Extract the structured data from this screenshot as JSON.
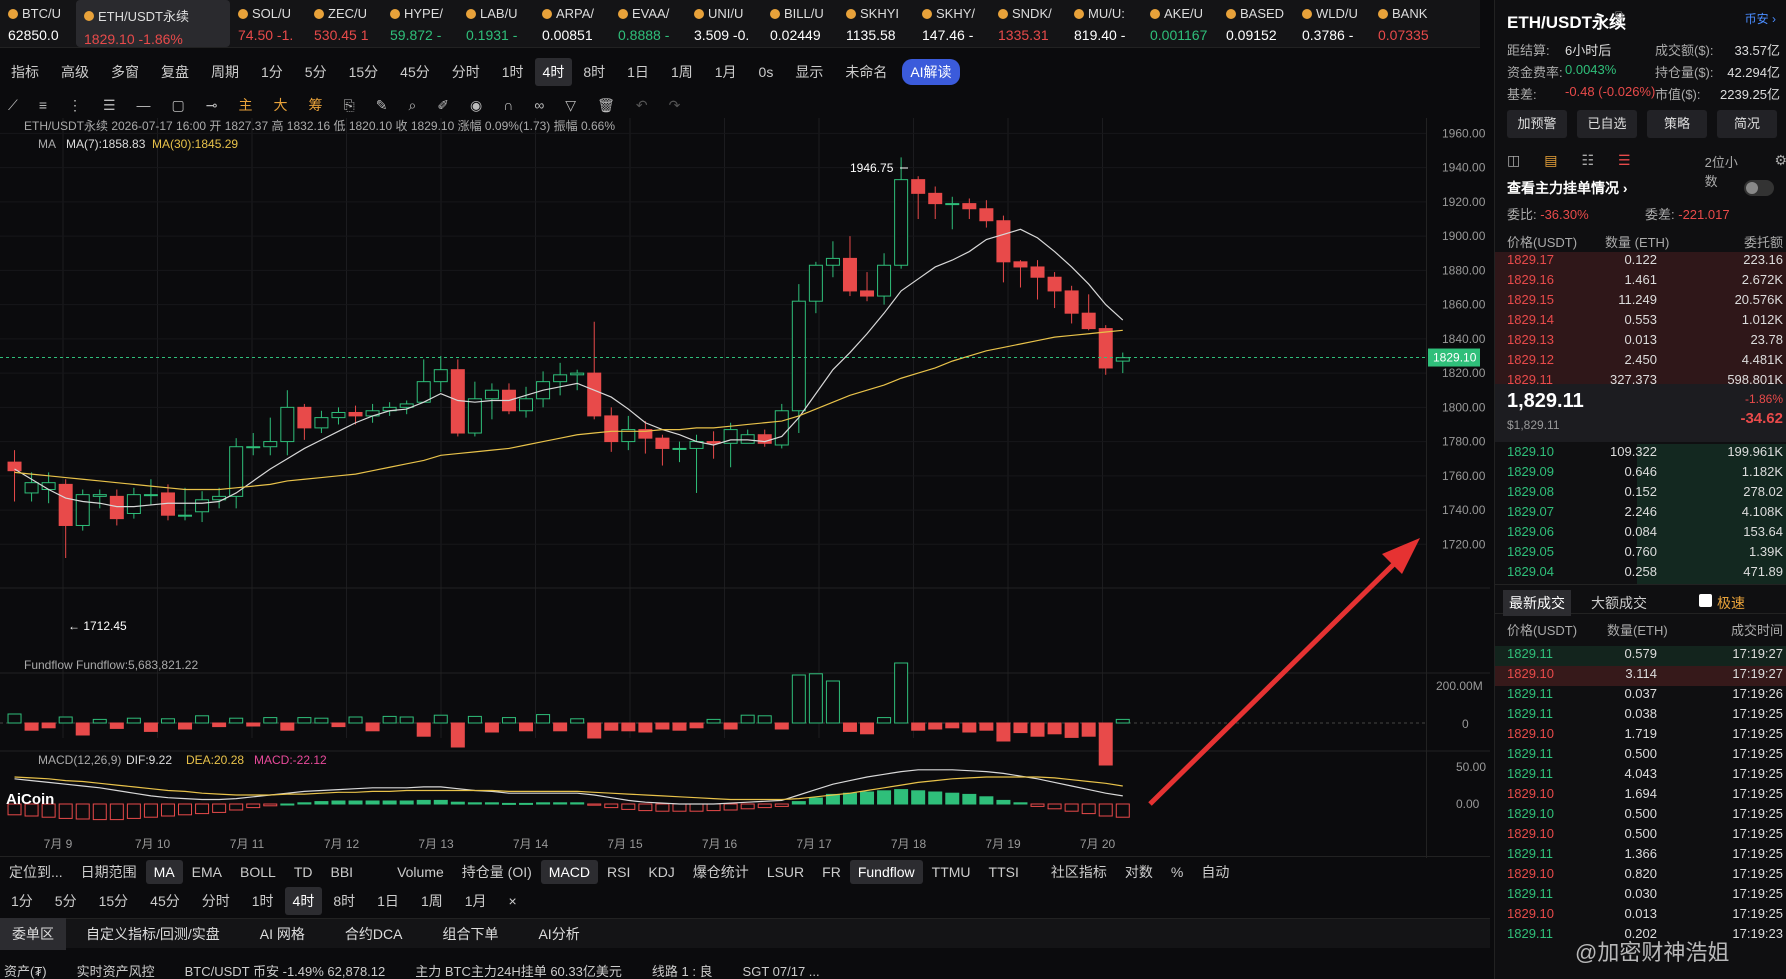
{
  "ticker": [
    {
      "name": "BTC/U",
      "value": "62850.0",
      "color": "#ffffff"
    },
    {
      "name": "ETH/USDT永续",
      "value": "1829.10  -1.86%",
      "color": "#e84a4a",
      "active": true
    },
    {
      "name": "SOL/U",
      "value": "74.50  -1.",
      "color": "#e84a4a"
    },
    {
      "name": "ZEC/U",
      "value": "530.45  1",
      "color": "#e84a4a"
    },
    {
      "name": "HYPE/",
      "value": "59.872  -",
      "color": "#2fbf7a"
    },
    {
      "name": "LAB/U",
      "value": "0.1931  -",
      "color": "#2fbf7a"
    },
    {
      "name": "ARPA/",
      "value": "0.00851",
      "color": "#ffffff"
    },
    {
      "name": "EVAA/",
      "value": "0.8888  -",
      "color": "#2fbf7a"
    },
    {
      "name": "UNI/U",
      "value": "3.509  -0.",
      "color": "#ffffff"
    },
    {
      "name": "BILL/U",
      "value": "0.02449",
      "color": "#ffffff"
    },
    {
      "name": "SKHYI",
      "value": "1135.58",
      "color": "#ffffff"
    },
    {
      "name": "SKHY/",
      "value": "147.46  -",
      "color": "#ffffff"
    },
    {
      "name": "SNDK/",
      "value": "1335.31",
      "color": "#e84a4a"
    },
    {
      "name": "MU/U:",
      "value": "819.40  -",
      "color": "#ffffff"
    },
    {
      "name": "AKE/U",
      "value": "0.001167",
      "color": "#2fbf7a"
    },
    {
      "name": "BASED",
      "value": "0.09152",
      "color": "#ffffff"
    },
    {
      "name": "WLD/U",
      "value": "0.3786  -",
      "color": "#ffffff"
    },
    {
      "name": "BANK",
      "value": "0.07335",
      "color": "#e84a4a"
    }
  ],
  "toolbar1": [
    "指标",
    "高级",
    "多窗",
    "复盘",
    "周期",
    "1分",
    "5分",
    "15分",
    "45分",
    "分时",
    "1时",
    "4时",
    "8时",
    "1日",
    "1周",
    "1月",
    "0s",
    "显示",
    "未命名",
    "AI解读"
  ],
  "toolbar1_selected": "4时",
  "toolbar2": [
    "主",
    "大",
    "筹"
  ],
  "chart_info": {
    "symbol_line": "ETH/USDT永续  2026-07-17 16:00  开 1827.37  高 1832.16  低 1820.10  收 1829.10  涨幅 0.09%(1.73)  振幅 0.66%",
    "ma_label": "MA",
    "ma7": "MA(7):1858.83",
    "ma30": "MA(30):1845.29",
    "fundflow_label": "Fundflow  Fundflow:5,683,821.22",
    "macd_label": "MACD(12,26,9)",
    "dif": "DIF:9.22",
    "dea": "DEA:20.28",
    "macd": "MACD:-22.12",
    "high_mark": "1946.75",
    "low_mark": "← 1712.45",
    "current_price_tag": "1829.10",
    "logo": "AiCoin"
  },
  "chart_data": {
    "type": "candlestick",
    "price_axis": [
      "1960.00",
      "1940.00",
      "1920.00",
      "1900.00",
      "1880.00",
      "1860.00",
      "1840.00",
      "1820.00",
      "1800.00",
      "1780.00",
      "1760.00",
      "1740.00",
      "1720.00"
    ],
    "ylim": [
      1712,
      1962
    ],
    "fund_axis": [
      "200.00M",
      "0"
    ],
    "macd_axis": [
      "50.00",
      "0.00"
    ],
    "x_labels": [
      "7月 9",
      "7月 10",
      "7月 11",
      "7月 12",
      "7月 13",
      "7月 14",
      "7月 15",
      "7月 16",
      "7月 17",
      "7月 18",
      "7月 19",
      "7月 20"
    ],
    "candles": [
      [
        1768,
        1763,
        1775,
        1745
      ],
      [
        1750,
        1756,
        1762,
        1745
      ],
      [
        1752,
        1756,
        1762,
        1744
      ],
      [
        1755,
        1731,
        1758,
        1712
      ],
      [
        1731,
        1749,
        1752,
        1728
      ],
      [
        1748,
        1749,
        1752,
        1741
      ],
      [
        1748,
        1735,
        1752,
        1731
      ],
      [
        1738,
        1749,
        1753,
        1735
      ],
      [
        1749,
        1749,
        1758,
        1743
      ],
      [
        1750,
        1737,
        1755,
        1734
      ],
      [
        1737,
        1737,
        1753,
        1734
      ],
      [
        1739,
        1746,
        1751,
        1733
      ],
      [
        1746,
        1748,
        1753,
        1741
      ],
      [
        1748,
        1777,
        1782,
        1741
      ],
      [
        1777,
        1777,
        1785,
        1772
      ],
      [
        1777,
        1780,
        1794,
        1772
      ],
      [
        1780,
        1800,
        1810,
        1772
      ],
      [
        1800,
        1788,
        1802,
        1781
      ],
      [
        1788,
        1794,
        1798,
        1785
      ],
      [
        1794,
        1797,
        1800,
        1790
      ],
      [
        1797,
        1795,
        1801,
        1790
      ],
      [
        1795,
        1798,
        1802,
        1791
      ],
      [
        1798,
        1800,
        1803,
        1795
      ],
      [
        1800,
        1802,
        1804,
        1796
      ],
      [
        1803,
        1815,
        1828,
        1803
      ],
      [
        1815,
        1822,
        1830,
        1809
      ],
      [
        1822,
        1785,
        1828,
        1783
      ],
      [
        1785,
        1805,
        1815,
        1783
      ],
      [
        1805,
        1810,
        1814,
        1793
      ],
      [
        1810,
        1798,
        1814,
        1796
      ],
      [
        1798,
        1805,
        1812,
        1794
      ],
      [
        1805,
        1815,
        1821,
        1800
      ],
      [
        1815,
        1819,
        1826,
        1807
      ],
      [
        1819,
        1820,
        1822,
        1810
      ],
      [
        1820,
        1795,
        1850,
        1793
      ],
      [
        1795,
        1780,
        1800,
        1774
      ],
      [
        1780,
        1787,
        1795,
        1775
      ],
      [
        1787,
        1782,
        1792,
        1773
      ],
      [
        1782,
        1776,
        1784,
        1766
      ],
      [
        1776,
        1776,
        1780,
        1768
      ],
      [
        1776,
        1780,
        1784,
        1750
      ],
      [
        1780,
        1779,
        1786,
        1770
      ],
      [
        1779,
        1787,
        1791,
        1765
      ],
      [
        1779,
        1784,
        1787,
        1779
      ],
      [
        1784,
        1779,
        1787,
        1777
      ],
      [
        1778,
        1798,
        1802,
        1776
      ],
      [
        1798,
        1862,
        1872,
        1785
      ],
      [
        1862,
        1883,
        1885,
        1855
      ],
      [
        1883,
        1887,
        1897,
        1876
      ],
      [
        1887,
        1868,
        1900,
        1865
      ],
      [
        1868,
        1865,
        1879,
        1862
      ],
      [
        1865,
        1883,
        1890,
        1860
      ],
      [
        1883,
        1933,
        1946,
        1881
      ],
      [
        1933,
        1925,
        1935,
        1910
      ],
      [
        1925,
        1919,
        1929,
        1910
      ],
      [
        1919,
        1919,
        1923,
        1904
      ],
      [
        1919,
        1916,
        1922,
        1910
      ],
      [
        1916,
        1909,
        1921,
        1905
      ],
      [
        1909,
        1885,
        1912,
        1873
      ],
      [
        1885,
        1882,
        1886,
        1870
      ],
      [
        1882,
        1876,
        1886,
        1863
      ],
      [
        1876,
        1868,
        1879,
        1858
      ],
      [
        1868,
        1855,
        1871,
        1849
      ],
      [
        1855,
        1846,
        1866,
        1845
      ],
      [
        1846,
        1823,
        1848,
        1819
      ],
      [
        1827,
        1829,
        1832,
        1820
      ]
    ],
    "ma7": [
      1764,
      1758,
      1752,
      1747,
      1745,
      1744,
      1742,
      1742,
      1743,
      1744,
      1744,
      1744,
      1745,
      1750,
      1757,
      1764,
      1770,
      1776,
      1781,
      1786,
      1791,
      1795,
      1798,
      1799,
      1803,
      1808,
      1804,
      1803,
      1804,
      1804,
      1807,
      1810,
      1812,
      1814,
      1810,
      1806,
      1799,
      1791,
      1787,
      1784,
      1780,
      1778,
      1781,
      1781,
      1780,
      1783,
      1794,
      1808,
      1822,
      1832,
      1843,
      1855,
      1868,
      1875,
      1882,
      1886,
      1891,
      1898,
      1901,
      1904,
      1899,
      1891,
      1882,
      1872,
      1860,
      1851
    ],
    "ma30": [
      1762,
      1761,
      1760,
      1759,
      1758,
      1757,
      1756,
      1755,
      1754,
      1753,
      1752,
      1752,
      1752,
      1753,
      1754,
      1755,
      1757,
      1758,
      1759,
      1760,
      1761,
      1763,
      1765,
      1767,
      1769,
      1772,
      1773,
      1774,
      1775,
      1776,
      1778,
      1780,
      1782,
      1784,
      1785,
      1786,
      1786,
      1786,
      1787,
      1787,
      1788,
      1788,
      1789,
      1790,
      1791,
      1792,
      1795,
      1799,
      1803,
      1807,
      1810,
      1813,
      1817,
      1820,
      1823,
      1827,
      1830,
      1833,
      1835,
      1837,
      1839,
      1841,
      1842,
      1843,
      1844,
      1845
    ],
    "fundflow": [
      15,
      -12,
      -8,
      10,
      -20,
      6,
      -9,
      8,
      -14,
      7,
      -10,
      12,
      -6,
      8,
      -5,
      9,
      -12,
      9,
      8,
      -6,
      10,
      -13,
      11,
      10,
      -22,
      13,
      -40,
      11,
      -15,
      9,
      -13,
      14,
      -13,
      7,
      -25,
      -12,
      -13,
      -15,
      -10,
      -12,
      -8,
      6,
      -10,
      13,
      12,
      -10,
      80,
      82,
      70,
      -14,
      -18,
      9,
      100,
      -12,
      -10,
      -8,
      -15,
      -12,
      -30,
      -16,
      -22,
      -18,
      -24,
      -22,
      -70,
      6
    ],
    "macd": [
      -18,
      -20,
      -22,
      -24,
      -25,
      -26,
      -26,
      -24,
      -22,
      -20,
      -18,
      -16,
      -14,
      -10,
      -6,
      -3,
      0,
      2,
      4,
      5,
      5,
      5,
      5,
      5,
      6,
      6,
      3,
      2,
      2,
      1,
      1,
      2,
      2,
      2,
      -2,
      -6,
      -9,
      -11,
      -12,
      -12,
      -12,
      -11,
      -10,
      -8,
      -6,
      -4,
      4,
      10,
      16,
      18,
      20,
      22,
      24,
      22,
      20,
      18,
      16,
      12,
      6,
      2,
      -4,
      -8,
      -12,
      -16,
      -20,
      -22
    ],
    "dif": [
      28,
      26,
      24,
      22,
      20,
      18,
      15,
      12,
      9,
      7,
      6,
      5,
      5,
      6,
      8,
      10,
      12,
      14,
      15,
      16,
      17,
      18,
      18,
      18,
      19,
      19,
      17,
      15,
      14,
      12,
      12,
      12,
      12,
      12,
      10,
      7,
      4,
      2,
      1,
      0,
      0,
      0,
      1,
      2,
      3,
      4,
      10,
      16,
      22,
      26,
      30,
      33,
      36,
      38,
      38,
      38,
      37,
      36,
      34,
      31,
      28,
      24,
      20,
      16,
      12,
      9
    ],
    "dea": [
      30,
      29,
      28,
      26,
      25,
      23,
      21,
      19,
      17,
      15,
      14,
      12,
      11,
      10,
      10,
      10,
      11,
      11,
      12,
      13,
      13,
      14,
      14,
      15,
      15,
      15,
      15,
      15,
      15,
      14,
      14,
      14,
      14,
      14,
      13,
      12,
      11,
      10,
      9,
      8,
      7,
      6,
      5,
      5,
      5,
      5,
      6,
      8,
      10,
      12,
      15,
      18,
      21,
      24,
      26,
      28,
      29,
      30,
      30,
      30,
      30,
      29,
      27,
      25,
      23,
      20
    ]
  },
  "toolbar3": [
    "定位到...",
    "日期范围",
    "MA",
    "EMA",
    "BOLL",
    "TD",
    "BBI",
    "Volume",
    "持仓量 (OI)",
    "MACD",
    "RSI",
    "KDJ",
    "爆仓统计",
    "LSUR",
    "FR",
    "Fundflow",
    "TTMU",
    "TTSI",
    "社区指标",
    "对数",
    "%",
    "自动"
  ],
  "toolbar3_selected": [
    "MA",
    "MACD",
    "Fundflow"
  ],
  "toolbar4": [
    "1分",
    "5分",
    "15分",
    "45分",
    "分时",
    "1时",
    "4时",
    "8时",
    "1日",
    "1周",
    "1月",
    "×"
  ],
  "toolbar4_selected": "4时",
  "bottom_tabs": [
    "委单区",
    "自定义指标/回测/实盘",
    "AI 网格",
    "合约DCA",
    "组合下单",
    "AI分析"
  ],
  "status": [
    "资产(₮)",
    "实时资产风控",
    "BTC/USDT 币安 -1.49% 62,878.12",
    "主力  BTC主力24H挂单 60.33亿美元",
    "线路 1 : 良",
    "SGT 07/17 ..."
  ],
  "right": {
    "title": "ETH/USDT永续",
    "exchange": "币安 ›",
    "stats": [
      {
        "k": "距结算:",
        "v": "6小时后",
        "k2": "成交额($):",
        "v2": "33.57亿"
      },
      {
        "k": "资金费率:",
        "v": "0.0043%",
        "k2": "持仓量($):",
        "v2": "42.294亿"
      },
      {
        "k": "基差:",
        "v": "-0.48 (-0.026%)",
        "k2": "市值($):",
        "v2": "2239.25亿"
      }
    ],
    "buttons": [
      "加预警",
      "已自选",
      "策略",
      "简况"
    ],
    "decimals": "2位小数",
    "depth_link": "查看主力挂单情况 ›",
    "weibi_k": "委比:",
    "weibi_v": "-36.30%",
    "weicha_k": "委差:",
    "weicha_v": "-221.017",
    "book_headers": [
      "价格(USDT)",
      "数量 (ETH)",
      "委托额"
    ],
    "asks": [
      [
        "1829.17",
        "0.122",
        "223.16"
      ],
      [
        "1829.16",
        "1.461",
        "2.672K"
      ],
      [
        "1829.15",
        "11.249",
        "20.576K"
      ],
      [
        "1829.14",
        "0.553",
        "1.012K"
      ],
      [
        "1829.13",
        "0.013",
        "23.78"
      ],
      [
        "1829.12",
        "2.450",
        "4.481K"
      ],
      [
        "1829.11",
        "327.373",
        "598.801K"
      ]
    ],
    "last_price": "1,829.11",
    "last_usd": "$1,829.11",
    "last_pct": "-1.86%",
    "last_chg": "-34.62",
    "bids": [
      [
        "1829.10",
        "109.322",
        "199.961K"
      ],
      [
        "1829.09",
        "0.646",
        "1.182K"
      ],
      [
        "1829.08",
        "0.152",
        "278.02"
      ],
      [
        "1829.07",
        "2.246",
        "4.108K"
      ],
      [
        "1829.06",
        "0.084",
        "153.64"
      ],
      [
        "1829.05",
        "0.760",
        "1.39K"
      ],
      [
        "1829.04",
        "0.258",
        "471.89"
      ]
    ],
    "trade_tabs": [
      "最新成交",
      "大额成交",
      "极速"
    ],
    "trade_headers": [
      "价格(USDT)",
      "数量(ETH)",
      "成交时间"
    ],
    "trades": [
      [
        "1829.11",
        "0.579",
        "17:19:27",
        "g"
      ],
      [
        "1829.10",
        "3.114",
        "17:19:27",
        "r"
      ],
      [
        "1829.11",
        "0.037",
        "17:19:26",
        "g"
      ],
      [
        "1829.11",
        "0.038",
        "17:19:25",
        "g"
      ],
      [
        "1829.10",
        "1.719",
        "17:19:25",
        "r"
      ],
      [
        "1829.11",
        "0.500",
        "17:19:25",
        "g"
      ],
      [
        "1829.11",
        "4.043",
        "17:19:25",
        "g"
      ],
      [
        "1829.10",
        "1.694",
        "17:19:25",
        "r"
      ],
      [
        "1829.10",
        "0.500",
        "17:19:25",
        "g"
      ],
      [
        "1829.10",
        "0.500",
        "17:19:25",
        "r"
      ],
      [
        "1829.11",
        "1.366",
        "17:19:25",
        "g"
      ],
      [
        "1829.10",
        "0.820",
        "17:19:25",
        "r"
      ],
      [
        "1829.11",
        "0.030",
        "17:19:25",
        "g"
      ],
      [
        "1829.10",
        "0.013",
        "17:19:25",
        "r"
      ],
      [
        "1829.11",
        "0.202",
        "17:19:23",
        "g"
      ]
    ],
    "watermark": "@加密财神浩姐"
  },
  "colors": {
    "up": "#2fbf7a",
    "down": "#e84a4a",
    "ma7": "#d8d8d8",
    "ma30": "#e8c24a",
    "arrow": "#e63232"
  }
}
